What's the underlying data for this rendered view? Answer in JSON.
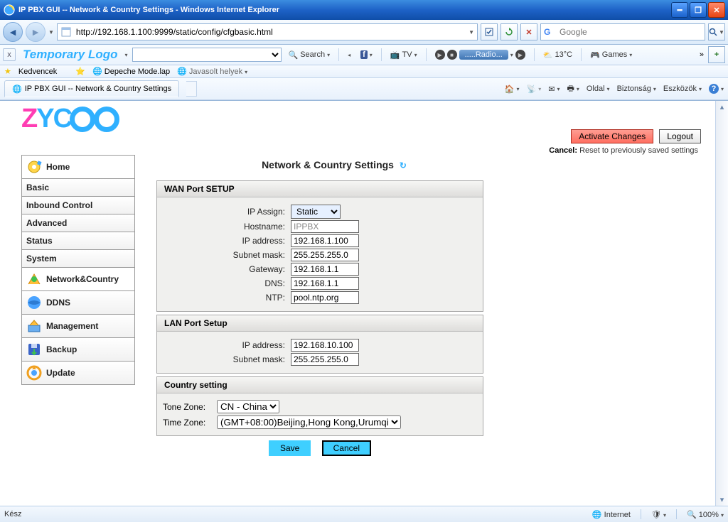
{
  "window": {
    "title": "IP PBX GUI -- Network & Country Settings - Windows Internet Explorer"
  },
  "address_bar": {
    "url": "http://192.168.1.100:9999/static/config/cfgbasic.html",
    "search_placeholder": "Google"
  },
  "toolbar2": {
    "logo": "Temporary Logo",
    "search": "Search",
    "tv": "TV",
    "radio": ".....Radio...",
    "temp": "13°C",
    "games": "Games"
  },
  "fav_row": {
    "favorites": "Kedvencek",
    "depeche": "Depeche Mode.lap",
    "suggested": "Javasolt helyek"
  },
  "tab": {
    "title": "IP PBX GUI -- Network & Country Settings"
  },
  "cmdbar": {
    "page": "Oldal",
    "security": "Biztonság",
    "tools": "Eszközök"
  },
  "pbx": {
    "page_title": "Network & Country Settings",
    "activate": "Activate Changes",
    "logout": "Logout",
    "cancel_label": "Cancel:",
    "cancel_note": "Reset to previously saved settings",
    "sidebar": {
      "home": "Home",
      "basic": "Basic",
      "inbound": "Inbound Control",
      "advanced": "Advanced",
      "status": "Status",
      "system": "System",
      "network": "Network&Country",
      "ddns": "DDNS",
      "management": "Management",
      "backup": "Backup",
      "update": "Update"
    },
    "wan": {
      "title": "WAN Port SETUP",
      "ip_assign_label": "IP Assign:",
      "ip_assign_value": "Static",
      "hostname_label": "Hostname:",
      "hostname_value": "IPPBX",
      "ip_label": "IP address:",
      "ip_value": "192.168.1.100",
      "subnet_label": "Subnet mask:",
      "subnet_value": "255.255.255.0",
      "gateway_label": "Gateway:",
      "gateway_value": "192.168.1.1",
      "dns_label": "DNS:",
      "dns_value": "192.168.1.1",
      "ntp_label": "NTP:",
      "ntp_value": "pool.ntp.org"
    },
    "lan": {
      "title": "LAN Port Setup",
      "ip_label": "IP address:",
      "ip_value": "192.168.10.100",
      "subnet_label": "Subnet mask:",
      "subnet_value": "255.255.255.0"
    },
    "country": {
      "title": "Country setting",
      "tone_label": "Tone Zone:",
      "tone_value": "CN - China",
      "time_label": "Time Zone:",
      "time_value": "(GMT+08:00)Beijing,Hong Kong,Urumqi"
    },
    "buttons": {
      "save": "Save",
      "cancel": "Cancel"
    }
  },
  "statusbar": {
    "ready": "Kész",
    "zone": "Internet",
    "zoom": "100%"
  }
}
